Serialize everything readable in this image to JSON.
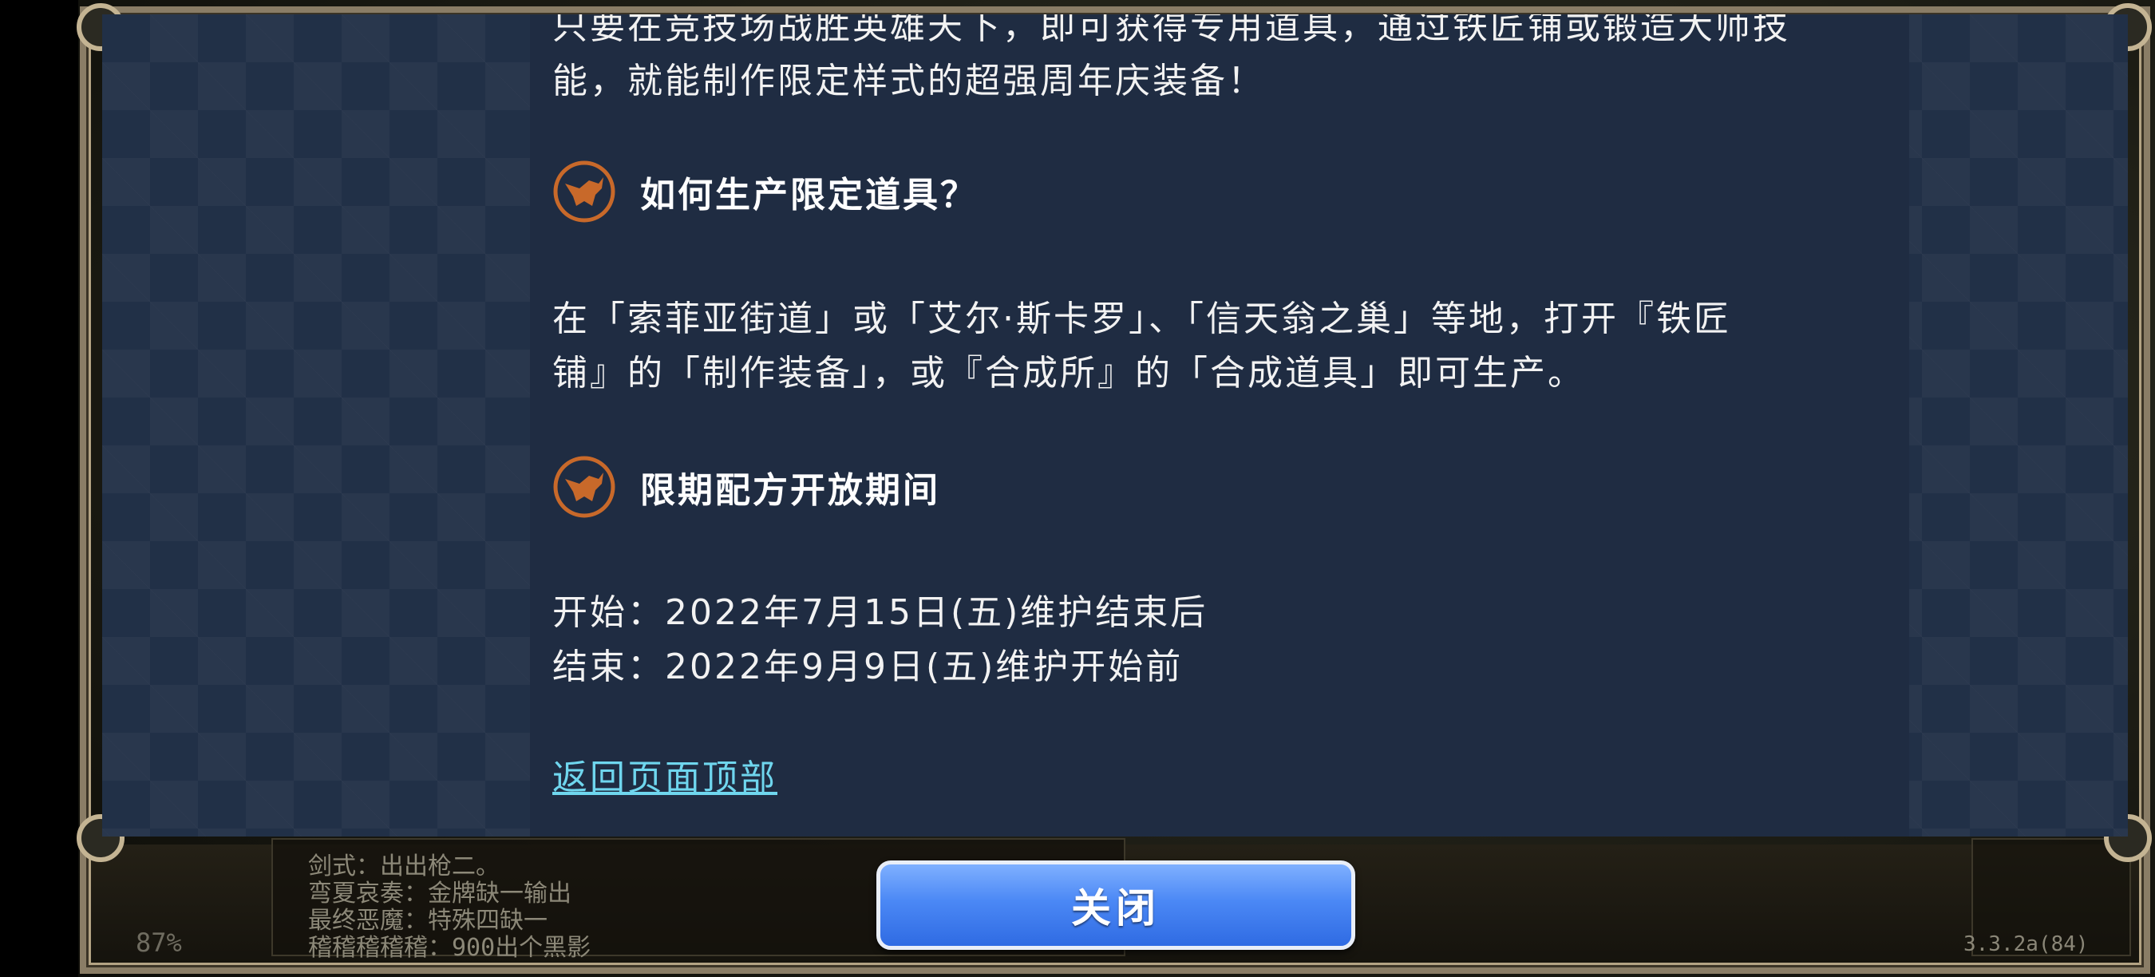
{
  "article": {
    "intro_line1": "只要在竞技场战胜英雄天下，即可获得专用道具，通过铁匠铺或锻造大师技",
    "intro_line2": "能，就能制作限定样式的超强周年庆装备！",
    "section1": {
      "heading": "如何生产限定道具？",
      "line1": "在「索菲亚街道」或「艾尔·斯卡罗」、「信天翁之巢」等地，打开『铁匠",
      "line2": "铺』的「制作装备」，或『合成所』的「合成道具」即可生产。"
    },
    "section2": {
      "heading": "限期配方开放期间",
      "start": "开始：2022年7月15日(五)维护结束后",
      "end": "结束：2022年9月9日(五)维护开始前"
    },
    "back_to_top": "返回页面顶部"
  },
  "footer": {
    "close_label": "关闭",
    "chat_lines": [
      "剑式：出出枪二。",
      "弯夏哀奏：金牌缺一输出",
      "最终恶魔：特殊四缺一",
      "稽稽稽稽稽：900出个黑影"
    ],
    "progress_text": "87%",
    "version": "3.3.2a(84)"
  },
  "icons": {
    "section_icon": "fox-head-icon"
  },
  "colors": {
    "panel_bg": "#213047",
    "link": "#6fd6ee",
    "close_button": "#4b88f5",
    "icon_orange": "#c8692a"
  }
}
